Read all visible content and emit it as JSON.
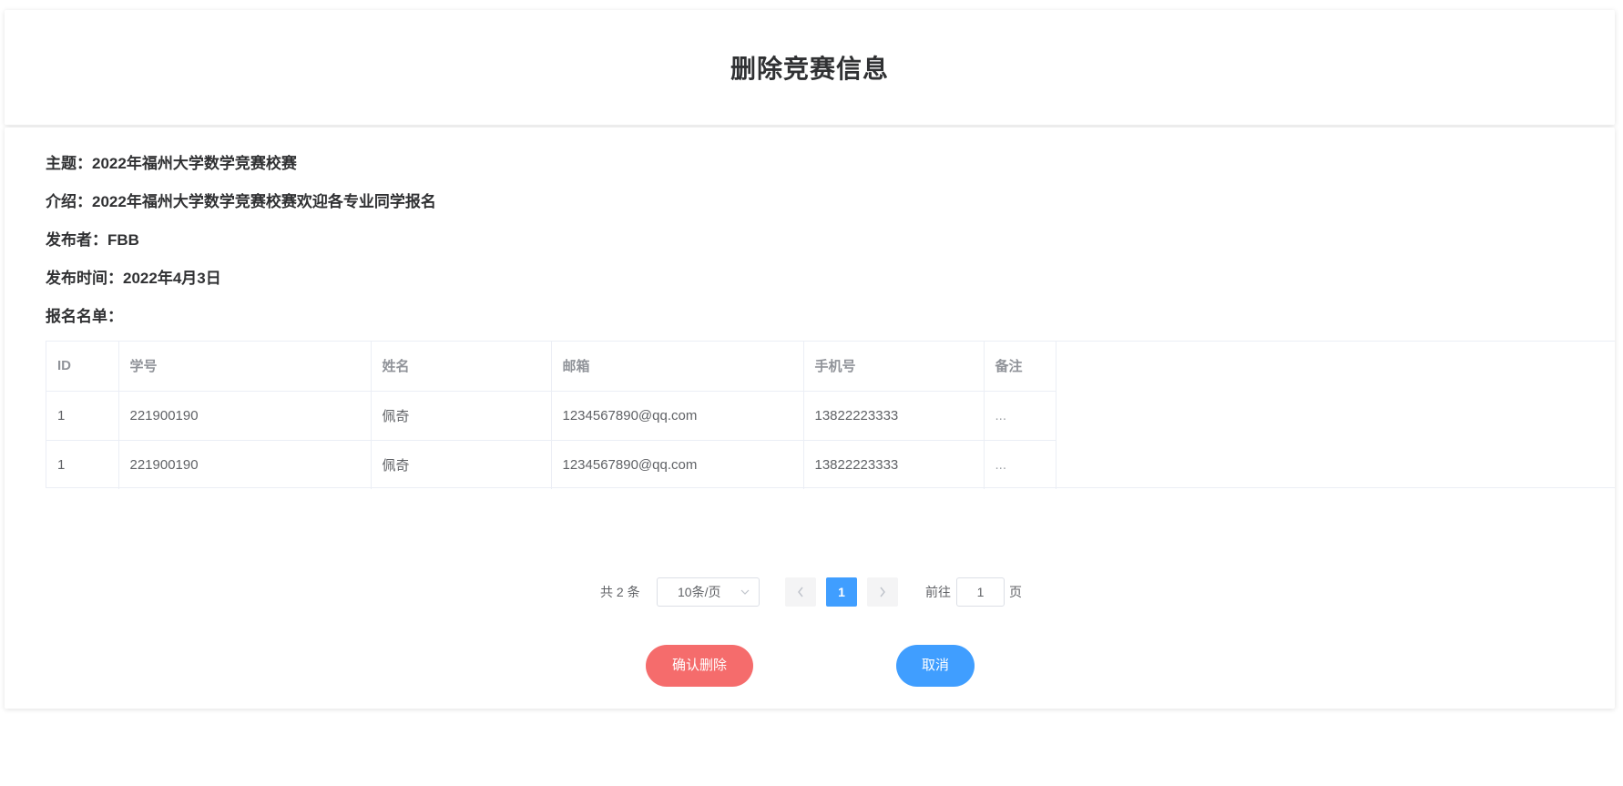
{
  "header": {
    "title": "删除竞赛信息"
  },
  "info": {
    "topic_label": "主题：",
    "topic_value": "2022年福州大学数学竞赛校赛",
    "intro_label": "介绍：",
    "intro_value": "2022年福州大学数学竞赛校赛欢迎各专业同学报名",
    "publisher_label": "发布者：",
    "publisher_value": "FBB",
    "time_label": "发布时间：",
    "time_value": "2022年4月3日",
    "roster_label": "报名名单："
  },
  "table": {
    "columns": [
      "ID",
      "学号",
      "姓名",
      "邮箱",
      "手机号",
      "备注"
    ],
    "rows": [
      [
        "1",
        "221900190",
        "佩奇",
        "1234567890@qq.com",
        "13822223333",
        "..."
      ],
      [
        "1",
        "221900190",
        "佩奇",
        "1234567890@qq.com",
        "13822223333",
        "..."
      ]
    ]
  },
  "pagination": {
    "total_text": "共 2 条",
    "page_size": "10条/页",
    "current_page": "1",
    "goto_prefix": "前往",
    "goto_value": "1",
    "goto_suffix": "页",
    "prev_icon": "chevron-left-icon",
    "next_icon": "chevron-right-icon"
  },
  "actions": {
    "confirm_label": "确认删除",
    "cancel_label": "取消"
  },
  "colors": {
    "primary": "#409eff",
    "danger": "#f56c6c"
  }
}
